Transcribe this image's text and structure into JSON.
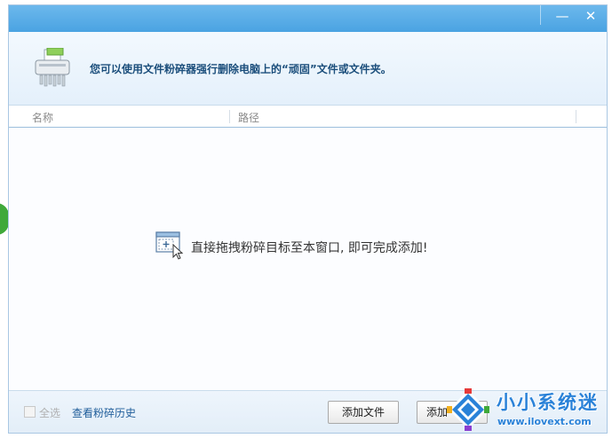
{
  "window": {
    "minimize_glyph": "—",
    "close_glyph": "✕"
  },
  "header": {
    "icon": "shredder-icon",
    "message": "您可以使用文件粉碎器强行删除电脑上的“顽固”文件或文件夹。"
  },
  "list": {
    "columns": [
      {
        "label": "名称"
      },
      {
        "label": "路径"
      }
    ],
    "empty_hint": "直接拖拽粉碎目标至本窗口, 即可完成添加!",
    "empty_icon": "drag-drop-icon"
  },
  "footer": {
    "select_all_label": "全选",
    "select_all_checked": false,
    "history_link": "查看粉碎历史",
    "add_file_label": "添加文件",
    "add_folder_label": "添加"
  },
  "watermark": {
    "title": "小小系统迷",
    "url": "www.ilovext.com"
  },
  "colors": {
    "titlebar": "#4aa3e2",
    "header_text": "#1c4f7c",
    "link": "#1f5d9a",
    "watermark": "#2a82d8"
  }
}
